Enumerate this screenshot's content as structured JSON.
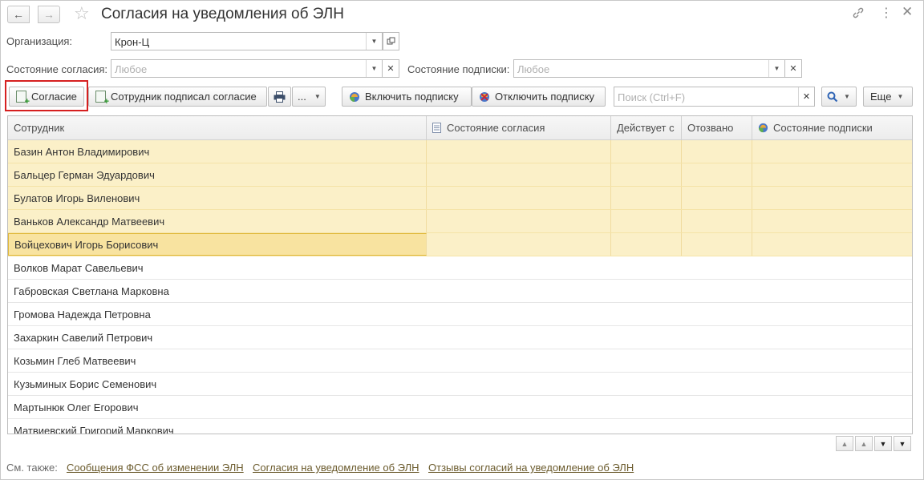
{
  "window": {
    "title": "Согласия на уведомления об ЭЛН"
  },
  "filters": {
    "org_label": "Организация:",
    "org_value": "Крон-Ц",
    "consent_state_label": "Состояние согласия:",
    "consent_state_placeholder": "Любое",
    "subscription_state_label": "Состояние подписки:",
    "subscription_state_placeholder": "Любое"
  },
  "toolbar": {
    "consent_label": "Согласие",
    "employee_signed_label": "Сотрудник подписал согласие",
    "more_dots_label": "...",
    "enable_sub_label": "Включить подписку",
    "disable_sub_label": "Отключить подписку",
    "search_placeholder": "Поиск (Ctrl+F)",
    "more_label": "Еще"
  },
  "table": {
    "columns": [
      "Сотрудник",
      "Состояние согласия",
      "Действует с",
      "Отозвано",
      "Состояние подписки"
    ],
    "rows": [
      "Базин Антон Владимирович",
      "Бальцер Герман Эдуардович",
      "Булатов Игорь Виленович",
      "Ваньков Александр Матвеевич",
      "Войцехович Игорь Борисович",
      "Волков Марат Савельевич",
      "Габровская Светлана Марковна",
      "Громова Надежда Петровна",
      "Захаркин Савелий Петрович",
      "Козьмин Глеб Матвеевич",
      "Кузьминых Борис Семенович",
      "Мартынюк Олег Егорович",
      "Матвиевский Григорий Маркович"
    ],
    "selected_count": 5,
    "current_row": 4
  },
  "see_also": {
    "label": "См. также:",
    "links": [
      "Сообщения ФСС об изменении ЭЛН",
      "Согласия на уведомление об ЭЛН",
      "Отзывы согласий на уведомление об ЭЛН"
    ]
  },
  "colors": {
    "selection": "#fbf0c8",
    "current_row_border": "#e0b83a",
    "highlight_frame": "#d62020",
    "link": "#6b5b2d"
  },
  "icons": [
    "back-arrow-icon",
    "forward-arrow-icon",
    "favorite-star-icon",
    "link-icon",
    "menu-dots-icon",
    "close-icon",
    "printer-icon",
    "search-icon",
    "subscription-icon"
  ]
}
